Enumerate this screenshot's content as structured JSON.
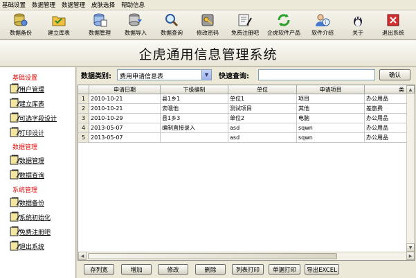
{
  "menu": [
    "基础设置",
    "数据管理",
    "数据管理",
    "皮肤选择",
    "帮助信息"
  ],
  "toolbar": [
    {
      "label": "数据备份",
      "icon": "database-disk-icon"
    },
    {
      "label": "建立库表",
      "icon": "folder-check-icon"
    },
    {
      "label": "数据管理",
      "icon": "data-list-icon"
    },
    {
      "label": "数据导入",
      "icon": "database-import-icon"
    },
    {
      "label": "数据查询",
      "icon": "magnifier-icon"
    },
    {
      "label": "修改密码",
      "icon": "key-icon"
    },
    {
      "label": "免费注册吧",
      "icon": "register-icon"
    },
    {
      "label": "企虎软件产品",
      "icon": "refresh-icon"
    },
    {
      "label": "软件介绍",
      "icon": "info-person-icon"
    },
    {
      "label": "关于",
      "icon": "bird-icon"
    },
    {
      "label": "退出系统",
      "icon": "exit-icon"
    }
  ],
  "banner_title": "企虎通用信息管理系统",
  "sidebar": {
    "sections": [
      {
        "title": "基础设置",
        "items": [
          "用户管理",
          "建立库表",
          "可选字段设计",
          "打印设计"
        ]
      },
      {
        "title": "数据管理",
        "items": [
          "数据管理",
          "数据查询"
        ]
      },
      {
        "title": "系统管理",
        "items": [
          "数据备份",
          "系统初始化",
          "免费注册吧",
          "退出系统"
        ]
      }
    ]
  },
  "filter": {
    "category_label": "数据类别:",
    "category_value": "费用申请信息表",
    "quick_label": "快速查询:",
    "quick_value": "",
    "confirm": "确认"
  },
  "table": {
    "columns": [
      "申请日期",
      "下级编制",
      "单位",
      "申请项目",
      "类"
    ],
    "rows": [
      [
        "1",
        "2010-10-21",
        "县1乡1",
        "单位1",
        "项目",
        "办公用品"
      ],
      [
        "2",
        "2010-10-21",
        "去哦他",
        "测试项目",
        "其他",
        "差旅费"
      ],
      [
        "3",
        "2010-10-29",
        "县1乡3",
        "单位2",
        "电脑",
        "办公用品"
      ],
      [
        "4",
        "2013-05-07",
        "编制直接录入",
        "asd",
        "sqwn",
        "办公用品"
      ],
      [
        "5",
        "2013-05-07",
        "",
        "asd",
        "sqwn",
        "办公用品"
      ]
    ]
  },
  "bottom_buttons": [
    "存列宽",
    "增加",
    "修改",
    "删除",
    "列表打印",
    "单据打印",
    "导出EXCEL"
  ],
  "colors": {
    "section_red": "#e01010",
    "background": "#d4d0c8",
    "accent_blue": "#7f9db9"
  }
}
